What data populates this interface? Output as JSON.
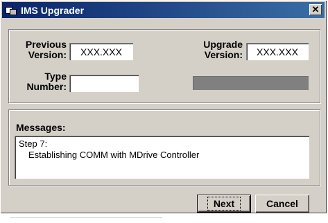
{
  "window": {
    "title": "IMS Upgrader",
    "close_glyph": "✕"
  },
  "version": {
    "previous_label_1": "Previous",
    "previous_label_2": "Version:",
    "previous_value": "XXX.XXX",
    "upgrade_label_1": "Upgrade",
    "upgrade_label_2": "Version:",
    "upgrade_value": "XXX.XXX",
    "type_label_1": "Type",
    "type_label_2": "Number:",
    "type_value": ""
  },
  "progress": {
    "fraction": 0
  },
  "messages": {
    "label": "Messages:",
    "line1": "Step 7:",
    "line2": "Establishing COMM with MDrive Controller"
  },
  "buttons": {
    "next": "Next",
    "cancel": "Cancel"
  },
  "colors": {
    "title_start": "#0a246a",
    "title_end": "#3a6ea5",
    "face": "#d4d0c8",
    "progress": "#808080"
  },
  "icons": {
    "app": "app-window-icon",
    "close": "close-icon"
  }
}
